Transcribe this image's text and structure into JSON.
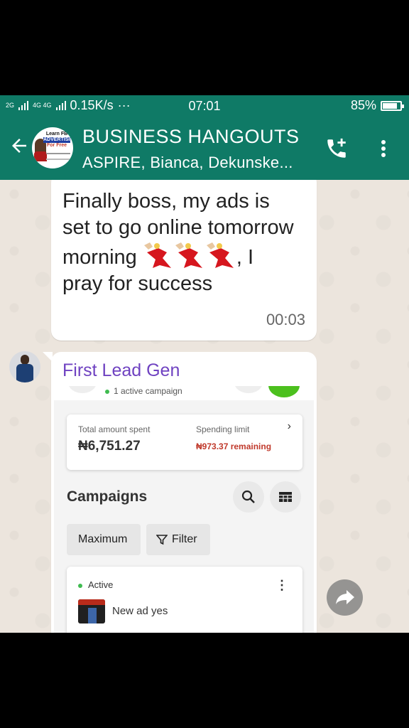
{
  "status_bar": {
    "network_label_1": "2G",
    "network_label_2": "4G 4G",
    "speed": "0.15K/s",
    "overflow": "···",
    "time": "07:01",
    "battery": "85%",
    "battery_level": 0.85
  },
  "header": {
    "title": "BUSINESS HANGOUTS",
    "subtitle": "ASPIRE, Bianca, Dekunske...",
    "avatar_lines": [
      "Learn FB",
      "ADVERTISING",
      "For Free"
    ],
    "color": "#0f7a66"
  },
  "messages": [
    {
      "text_before_emoji": "Finally boss, my ads is set to go online tomorrow morning",
      "text_after_emoji": ", I pray for success",
      "emoji": "dancer-emoji",
      "time": "00:03"
    },
    {
      "sender": "First Lead Gen",
      "sender_color": "#6f42c1",
      "screenshot": {
        "active_campaigns": "1 active campaign",
        "total_spent_label": "Total amount spent",
        "total_spent_value": "₦6,751.27",
        "spending_limit_label": "Spending limit",
        "spending_limit_value": "₦973.37 remaining",
        "campaigns_title": "Campaigns",
        "chip_maximum": "Maximum",
        "chip_filter": "Filter",
        "ad_status": "Active",
        "ad_name": "New ad yes"
      }
    }
  ]
}
